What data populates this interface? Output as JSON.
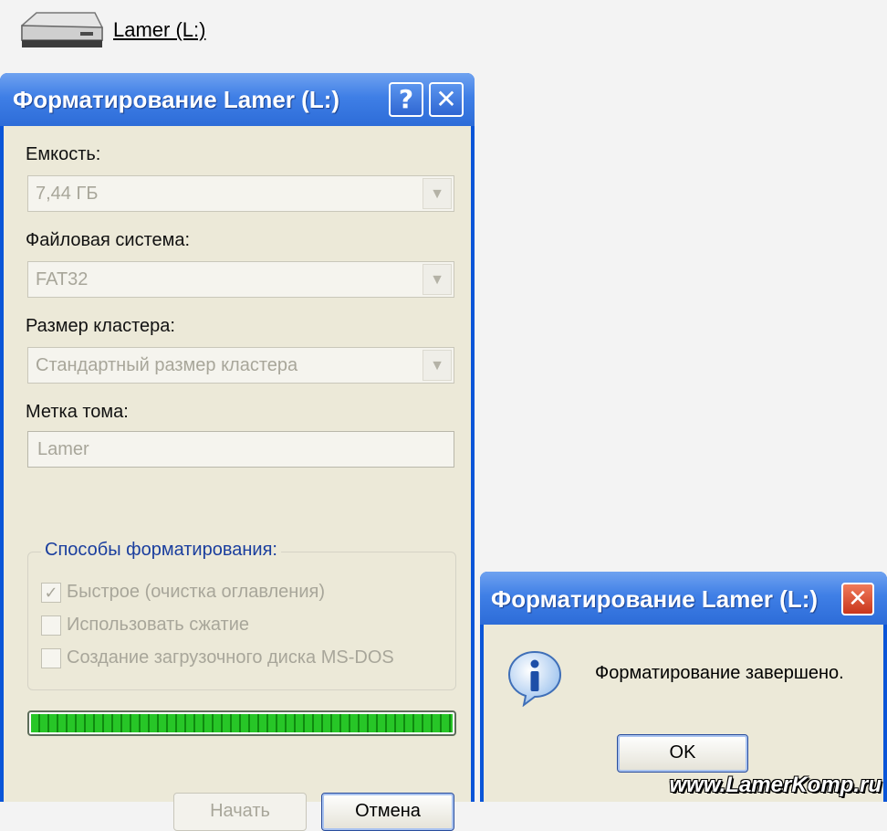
{
  "drive": {
    "label": "Lamer (L:)",
    "icon": "drive-icon"
  },
  "format_dialog": {
    "title": "Форматирование Lamer (L:)",
    "help_glyph": "?",
    "close_glyph": "✕",
    "capacity": {
      "label": "Емкость:",
      "value": "7,44 ГБ"
    },
    "file_system": {
      "label": "Файловая система:",
      "value": "FAT32"
    },
    "cluster_size": {
      "label": "Размер кластера:",
      "value": "Стандартный размер кластера"
    },
    "volume_label": {
      "label": "Метка тома:",
      "value": "Lamer"
    },
    "format_options": {
      "title": "Способы форматирования:",
      "options": [
        {
          "label": "Быстрое (очистка оглавления)",
          "checked": true
        },
        {
          "label": "Использовать сжатие",
          "checked": false
        },
        {
          "label": "Создание загрузочного диска MS-DOS",
          "checked": false
        }
      ]
    },
    "progress": 1.0,
    "start_button": "Начать",
    "cancel_button": "Отмена"
  },
  "message_dialog": {
    "title": "Форматирование Lamer (L:)",
    "close_glyph": "✕",
    "icon": "info-icon",
    "message": "Форматирование завершено.",
    "ok_button": "OK"
  },
  "watermark": "www.LamerKomp.ru",
  "colors": {
    "titlebar": "#2d6cd8",
    "dialog_bg": "#ece9d8",
    "progress": "#27c627",
    "close_red": "#c9361c"
  }
}
